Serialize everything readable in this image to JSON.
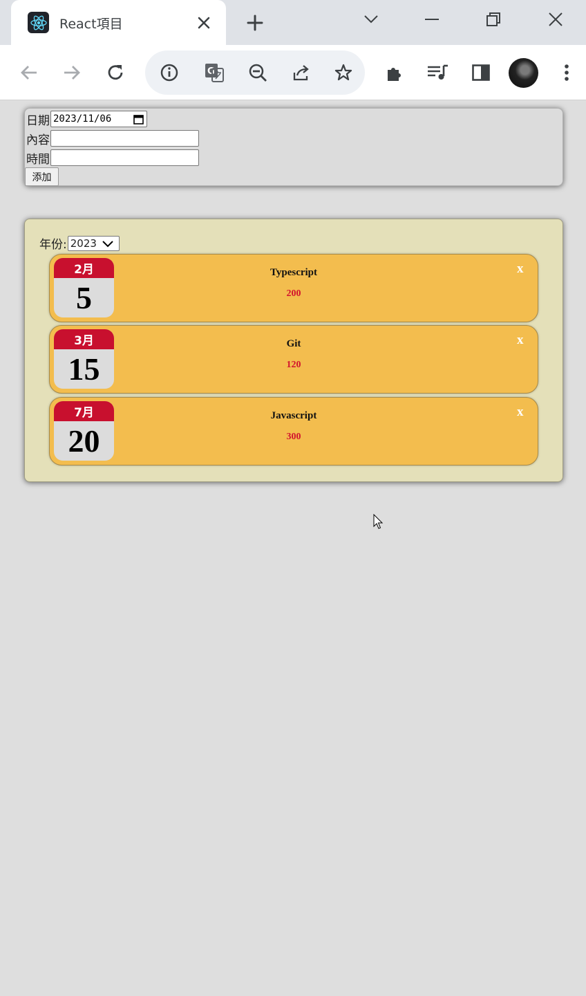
{
  "browser": {
    "tab_title": "React項目",
    "icons": [
      "react-logo-icon",
      "close-icon",
      "plus-icon",
      "chevron-down-icon",
      "minimize-icon",
      "restore-icon",
      "close-window-icon",
      "back-arrow-icon",
      "forward-arrow-icon",
      "reload-icon",
      "info-icon",
      "translate-icon",
      "zoom-out-icon",
      "share-icon",
      "star-icon",
      "extensions-icon",
      "media-icon",
      "side-panel-icon",
      "menu-dots-icon"
    ]
  },
  "form": {
    "date_label": "日期",
    "date_value": "2023/11/06",
    "content_label": "內容",
    "content_value": "",
    "time_label": "時間",
    "time_value": "",
    "add_button": "添加"
  },
  "list": {
    "year_label": "年份:",
    "year_selected": "2023",
    "delete_label": "x",
    "items": [
      {
        "month": "2月",
        "day": "5",
        "title": "Typescript",
        "time": "200"
      },
      {
        "month": "3月",
        "day": "15",
        "title": "Git",
        "time": "120"
      },
      {
        "month": "7月",
        "day": "20",
        "title": "Javascript",
        "time": "300"
      }
    ]
  },
  "colors": {
    "page_bg": "#dedede",
    "list_bg": "#e4e0b9",
    "item_bg": "#f3bd4e",
    "calendar_red": "#c8102e",
    "time_red": "#d2132e"
  }
}
